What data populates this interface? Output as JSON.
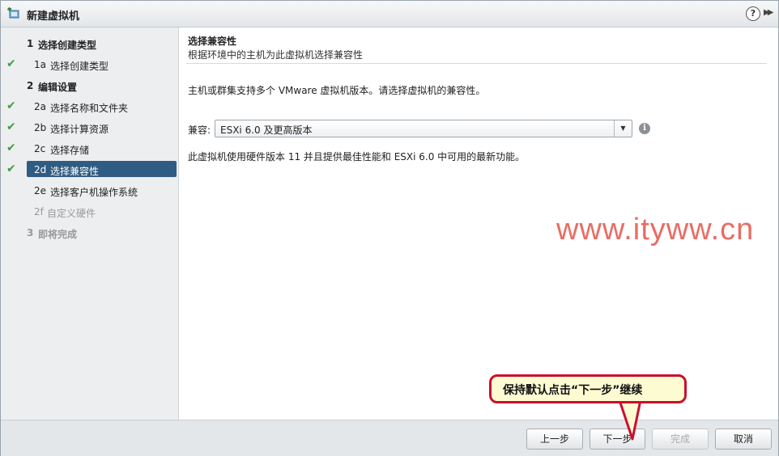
{
  "window": {
    "title": "新建虚拟机",
    "help": "?",
    "expand": "▶▶"
  },
  "steps": [
    {
      "num": "1",
      "label": "选择创建类型",
      "level": "main",
      "state": "normal",
      "checked": false
    },
    {
      "num": "1a",
      "label": "选择创建类型",
      "level": "sub",
      "state": "done",
      "checked": true
    },
    {
      "num": "2",
      "label": "编辑设置",
      "level": "main",
      "state": "normal",
      "checked": false
    },
    {
      "num": "2a",
      "label": "选择名称和文件夹",
      "level": "sub",
      "state": "done",
      "checked": true
    },
    {
      "num": "2b",
      "label": "选择计算资源",
      "level": "sub",
      "state": "done",
      "checked": true
    },
    {
      "num": "2c",
      "label": "选择存储",
      "level": "sub",
      "state": "done",
      "checked": true
    },
    {
      "num": "2d",
      "label": "选择兼容性",
      "level": "sub",
      "state": "active",
      "checked": true
    },
    {
      "num": "2e",
      "label": "选择客户机操作系统",
      "level": "sub",
      "state": "normal",
      "checked": false
    },
    {
      "num": "2f",
      "label": "自定义硬件",
      "level": "sub",
      "state": "disabled",
      "checked": false
    },
    {
      "num": "3",
      "label": "即将完成",
      "level": "main",
      "state": "disabled",
      "checked": false
    }
  ],
  "content": {
    "title": "选择兼容性",
    "subtitle": "根据环境中的主机为此虚拟机选择兼容性",
    "description": "主机或群集支持多个 VMware 虚拟机版本。请选择虚拟机的兼容性。",
    "compat_label": "兼容:",
    "compat_value": "ESXi 6.0 及更高版本",
    "hw_note": "此虚拟机使用硬件版本 11 并且提供最佳性能和 ESXi 6.0 中可用的最新功能。"
  },
  "watermark": "www.ityww.cn",
  "callout": "保持默认点击“下一步”继续",
  "footer": {
    "back": "上一步",
    "next": "下一步",
    "finish": "完成",
    "cancel": "取消"
  },
  "colors": {
    "active_step": "#2f5c82",
    "check": "#3f9e3f",
    "callout_border": "#c8102e",
    "callout_bg": "#fdfbd2",
    "watermark": "#e86d64"
  }
}
